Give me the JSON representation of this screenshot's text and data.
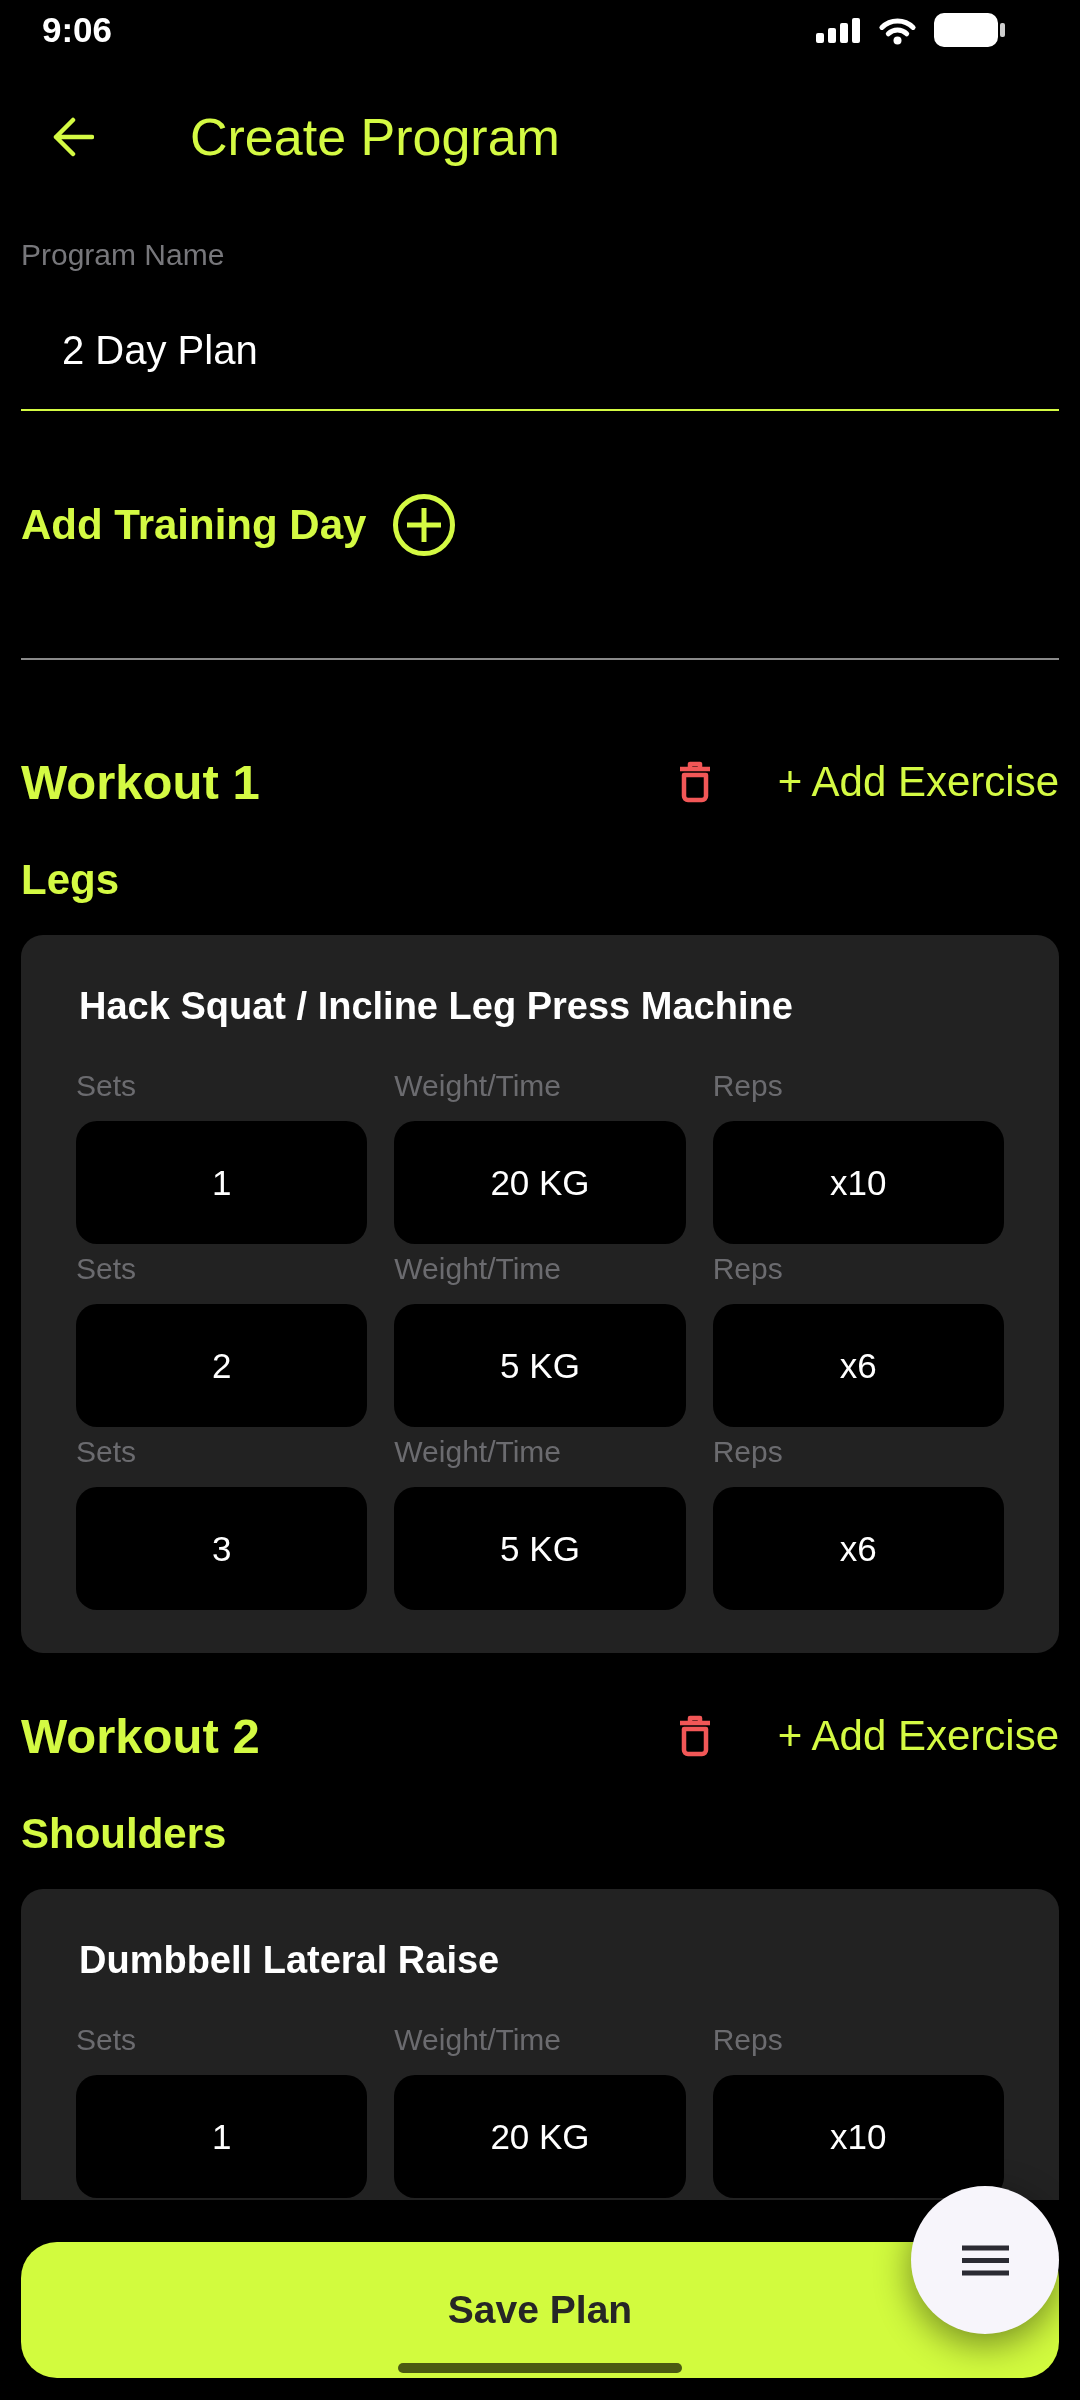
{
  "status_bar": {
    "time": "9:06"
  },
  "header": {
    "title": "Create Program"
  },
  "program_name": {
    "label": "Program Name",
    "value": "2 Day Plan"
  },
  "add_training_day": {
    "label": "Add Training Day"
  },
  "workouts": [
    {
      "title": "Workout 1",
      "add_exercise": "+ Add Exercise",
      "category": "Legs",
      "exercises": [
        {
          "name": "Hack Squat / Incline Leg Press Machine",
          "rows": [
            {
              "fields": [
                {
                  "label": "Sets",
                  "value": "1"
                },
                {
                  "label": "Weight/Time",
                  "value": "20 KG"
                },
                {
                  "label": "Reps",
                  "value": "x10"
                }
              ]
            },
            {
              "fields": [
                {
                  "label": "Sets",
                  "value": "2"
                },
                {
                  "label": "Weight/Time",
                  "value": "5 KG"
                },
                {
                  "label": "Reps",
                  "value": "x6"
                }
              ]
            },
            {
              "fields": [
                {
                  "label": "Sets",
                  "value": "3"
                },
                {
                  "label": "Weight/Time",
                  "value": "5 KG"
                },
                {
                  "label": "Reps",
                  "value": "x6"
                }
              ]
            }
          ]
        }
      ]
    },
    {
      "title": "Workout 2",
      "add_exercise": "+ Add Exercise",
      "category": "Shoulders",
      "exercises": [
        {
          "name": "Dumbbell Lateral Raise",
          "rows": [
            {
              "fields": [
                {
                  "label": "Sets",
                  "value": "1"
                },
                {
                  "label": "Weight/Time",
                  "value": "20 KG"
                },
                {
                  "label": "Reps",
                  "value": "x10"
                }
              ]
            }
          ]
        }
      ]
    }
  ],
  "save_button": {
    "label": "Save Plan"
  }
}
